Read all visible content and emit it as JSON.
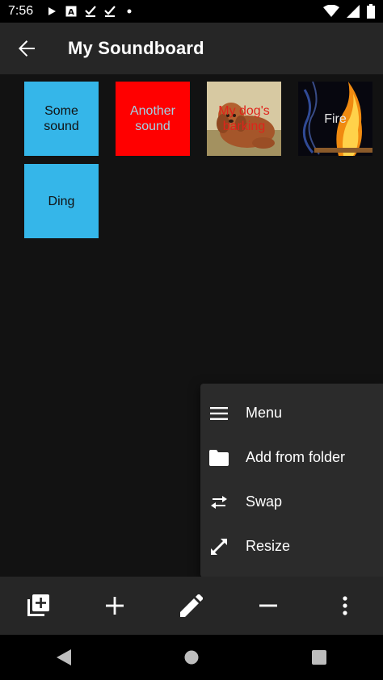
{
  "status_bar": {
    "time": "7:56",
    "left_icons": [
      "play-icon",
      "text-a-icon",
      "check-download-icon",
      "check-download-icon",
      "dot-icon"
    ],
    "right_icons": [
      "wifi-icon",
      "signal-icon",
      "battery-icon"
    ]
  },
  "app_bar": {
    "title": "My Soundboard",
    "back_icon": "arrow-back-icon"
  },
  "colors": {
    "background": "#121212",
    "bar": "#262626",
    "blue_tile": "#35b6e9",
    "red_tile": "#ff0000",
    "menu_bg": "#2b2b2b"
  },
  "tiles": [
    {
      "label": "Some sound",
      "color": "#35b6e9",
      "text_color": "#111111"
    },
    {
      "label": "Another sound",
      "color": "#ff0000",
      "text_color": "#a0d3e6"
    },
    {
      "label": "My dog's barking",
      "color": "photo-dog",
      "text_color": "#e0231b"
    },
    {
      "label": "Fire",
      "color": "photo-fire",
      "text_color": "#e8e8e8"
    },
    {
      "label": "Ding",
      "color": "#35b6e9",
      "text_color": "#111111"
    }
  ],
  "menu": {
    "items": [
      {
        "label": "Menu",
        "icon": "hamburger-icon"
      },
      {
        "label": "Add from folder",
        "icon": "folder-icon"
      },
      {
        "label": "Swap",
        "icon": "swap-icon"
      },
      {
        "label": "Resize",
        "icon": "resize-icon"
      }
    ]
  },
  "bottom_bar": {
    "buttons": [
      "add-library-icon",
      "plus-icon",
      "pencil-icon",
      "minus-icon",
      "more-vert-icon"
    ]
  },
  "nav_bar": {
    "buttons": [
      "back-triangle-icon",
      "home-circle-icon",
      "recents-square-icon"
    ]
  }
}
